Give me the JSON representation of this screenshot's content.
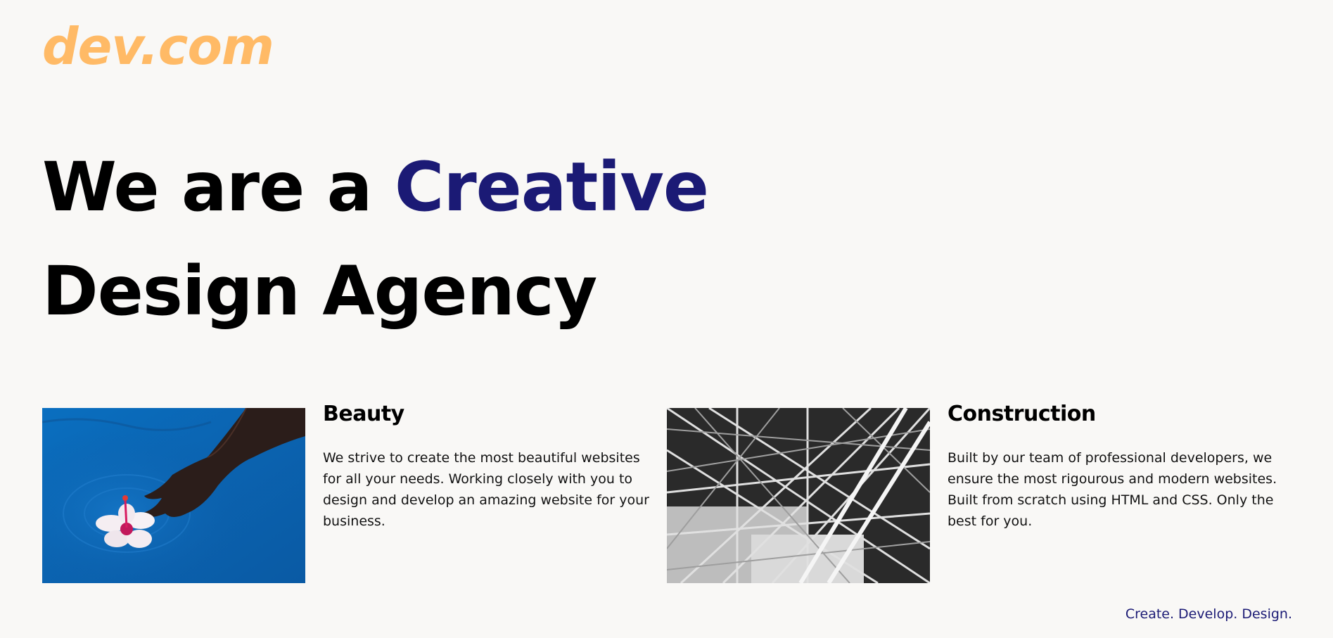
{
  "brand": {
    "logo_text": "dev.com",
    "logo_color": "#ffba66",
    "accent_color": "#1b1a75",
    "background": "#f9f8f6"
  },
  "hero": {
    "line1_prefix": "We are a",
    "line1_accent": "Creative",
    "line2": "Design Agency"
  },
  "cards": [
    {
      "image_icon": "hand-in-water-flower-photo",
      "title": "Beauty",
      "body": "We strive to create the most beautiful websites for all your needs. Working closely with you to design and develop an amazing website for your business."
    },
    {
      "image_icon": "steel-structure-photo",
      "title": "Construction",
      "body": "Built by our team of professional developers, we ensure the most rigourous and modern websites. Built from scratch using HTML and CSS. Only the best for you."
    }
  ],
  "footer": {
    "tagline": "Create. Develop. Design."
  }
}
